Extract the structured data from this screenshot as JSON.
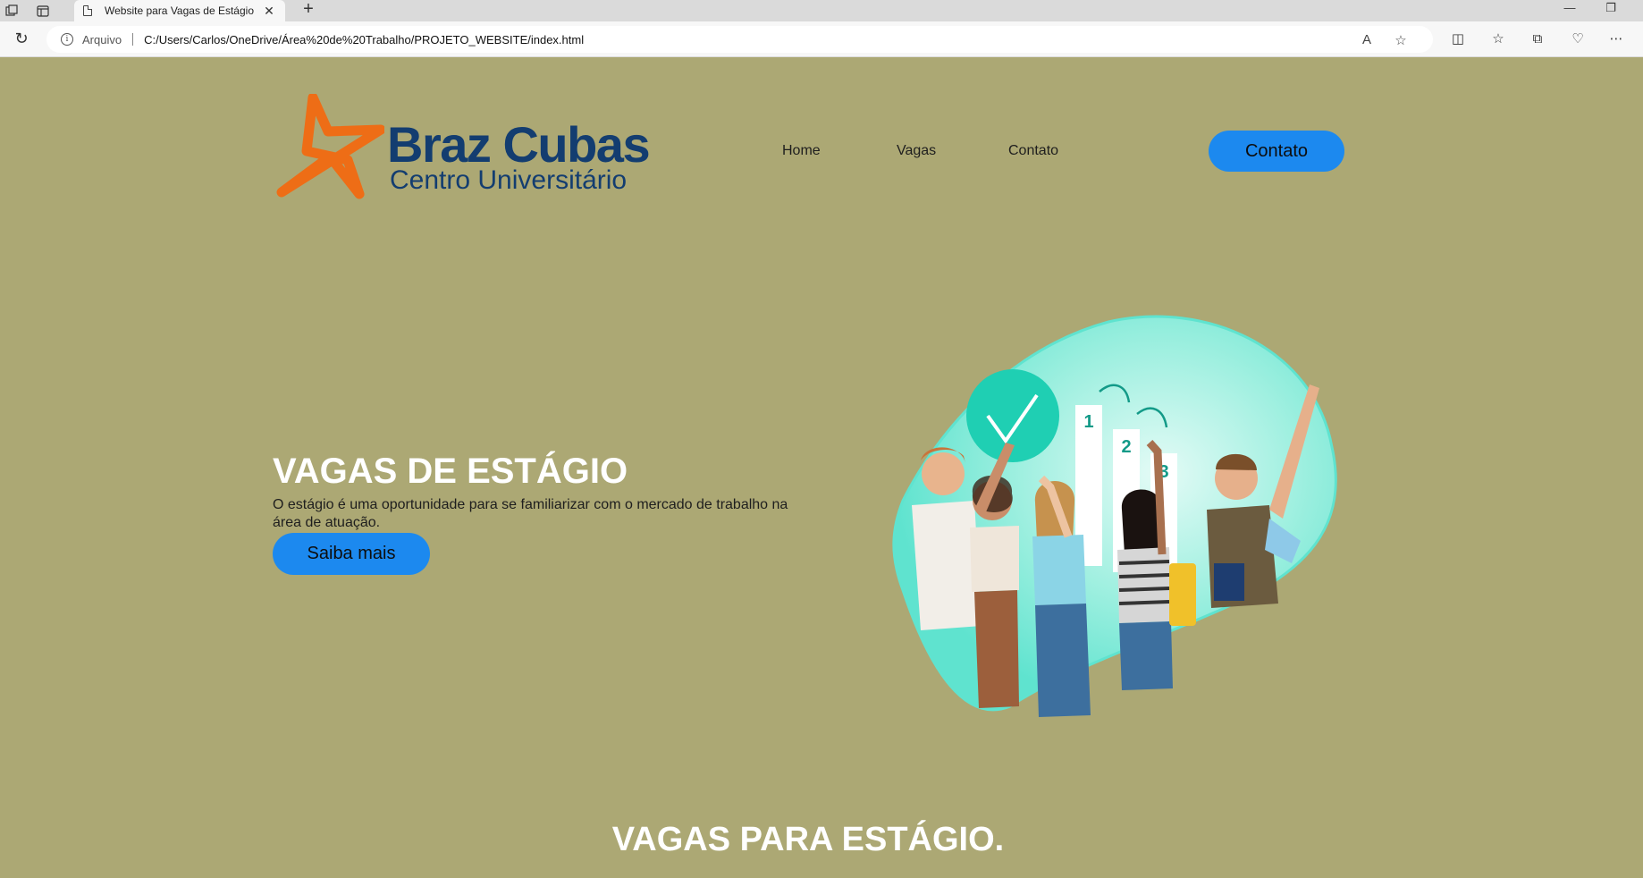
{
  "browser": {
    "tab_title": "Website para Vagas de Estágio",
    "address_label": "Arquivo",
    "url": "C:/Users/Carlos/OneDrive/Área%20de%20Trabalho/PROJETO_WEBSITE/index.html"
  },
  "logo": {
    "title": "Braz Cubas",
    "subtitle": "Centro Universitário"
  },
  "nav": {
    "items": [
      {
        "label": "Home"
      },
      {
        "label": "Vagas"
      },
      {
        "label": "Contato"
      }
    ],
    "cta_label": "Contato"
  },
  "hero": {
    "title": "VAGAS DE ESTÁGIO",
    "text": "O estágio é uma oportunidade para se familiarizar com o mercado de trabalho na área de atuação.",
    "button_label": "Saiba mais",
    "steps": [
      "1",
      "2",
      "3"
    ]
  },
  "section": {
    "title": "VAGAS PARA ESTÁGIO."
  },
  "colors": {
    "page_bg": "#aca874",
    "button": "#1c89ef",
    "logo_blue": "#133d70",
    "logo_orange": "#ee6d16",
    "hero_glow": "#5fe3cf"
  }
}
